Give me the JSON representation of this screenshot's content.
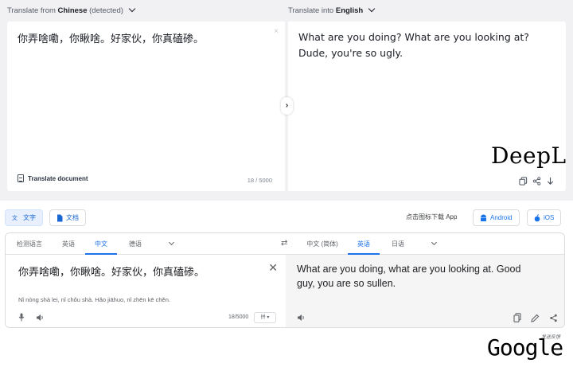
{
  "deepl": {
    "from_prefix": "Translate from",
    "from_lang": "Chinese",
    "from_suffix": "(detected)",
    "into_prefix": "Translate into",
    "into_lang": "English",
    "source_text": "你弄啥嘞，你瞅啥。好家伙，你真磕碜。",
    "clear_icon": "×",
    "translate_document_label": "Translate document",
    "char_count": "18 / 5000",
    "swap_icon": "›",
    "target_text": "What are you doing? What are you looking at? Dude, you're so ugly.",
    "brand_label": "DeepL",
    "action_icons": [
      "copy-icon",
      "share-icon",
      "download-icon"
    ]
  },
  "google": {
    "modes": {
      "text_label": "文字",
      "docs_label": "文档"
    },
    "app_label": "点击图标下载 App",
    "android_label": "Android",
    "ios_label": "iOS",
    "source_tabs": [
      "检测语言",
      "英语",
      "中文",
      "德语"
    ],
    "source_active": "中文",
    "target_tabs": [
      "中文 (简体)",
      "英语",
      "日语"
    ],
    "target_active": "英语",
    "swap_icon": "⇄",
    "source_text": "你弄啥嘞，你瞅啥。好家伙，你真磕碜。",
    "clear_icon": "✕",
    "pinyin": "Nǐ nòng shà lei, nǐ chǒu shà. Hǎo jiāhuo, nǐ zhēn kē chěn.",
    "char_count": "18/5000",
    "keyboard_label": "拼 ▾",
    "target_text": "What are you doing, what are you looking at. Good guy, you are so sullen.",
    "feedback_label": "发送反馈",
    "brand_label": "Google",
    "accent_color": "#1a73e8"
  }
}
